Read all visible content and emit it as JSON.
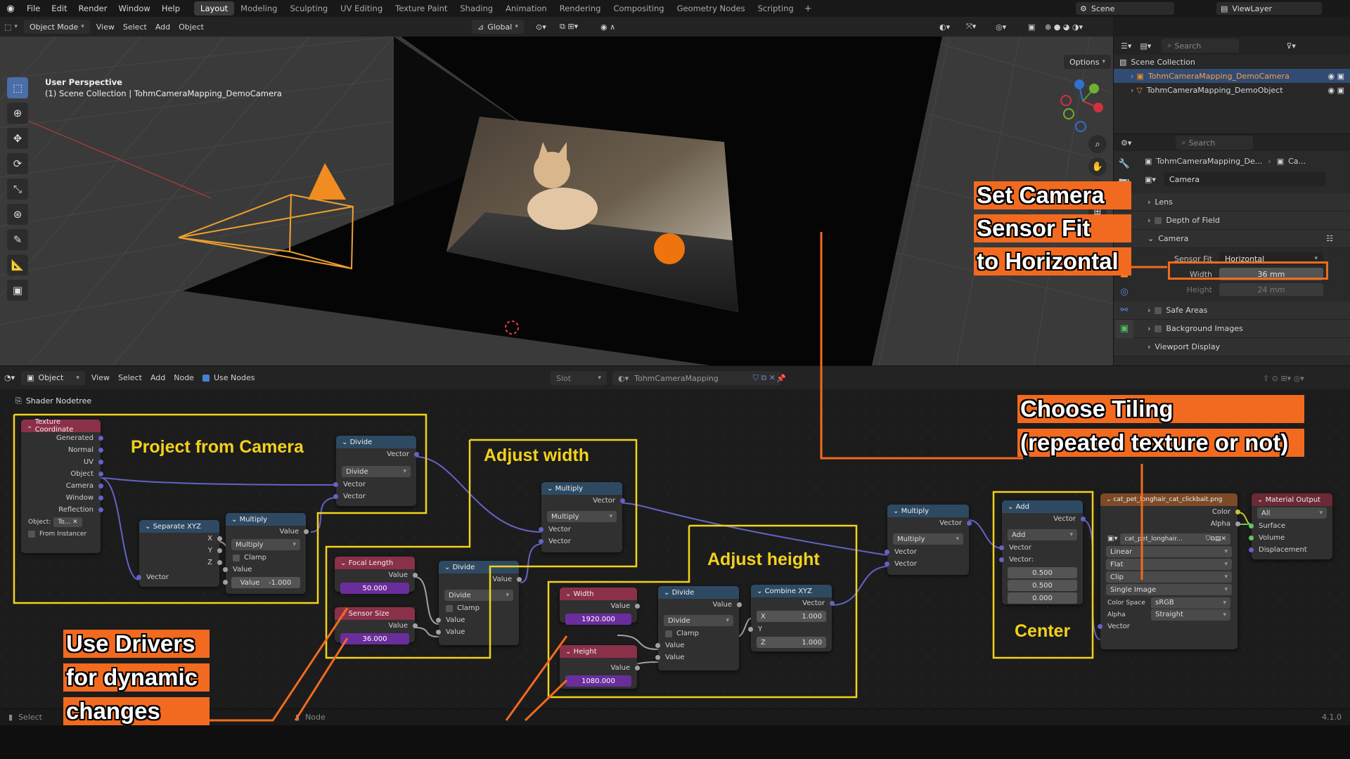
{
  "app": {
    "menus": [
      "File",
      "Edit",
      "Render",
      "Window",
      "Help"
    ],
    "workspaces": [
      "Layout",
      "Modeling",
      "Sculpting",
      "UV Editing",
      "Texture Paint",
      "Shading",
      "Animation",
      "Rendering",
      "Compositing",
      "Geometry Nodes",
      "Scripting"
    ],
    "active_workspace": "Layout",
    "scene": "Scene",
    "view_layer": "ViewLayer",
    "version": "4.1.0"
  },
  "viewport": {
    "mode": "Object Mode",
    "menus": [
      "View",
      "Select",
      "Add",
      "Object"
    ],
    "transform": "Global",
    "options": "Options",
    "title": "User Perspective",
    "subtitle": "(1) Scene Collection | TohmCameraMapping_DemoCamera"
  },
  "outliner": {
    "search_placeholder": "Search",
    "collection": "Scene Collection",
    "items": [
      "TohmCameraMapping_DemoCamera",
      "TohmCameraMapping_DemoObject"
    ]
  },
  "properties": {
    "search_placeholder": "Search",
    "breadcrumb_obj": "TohmCameraMapping_De...",
    "breadcrumb_data": "Ca...",
    "datablock": "Camera",
    "panels": {
      "lens": "Lens",
      "dof": "Depth of Field",
      "camera": "Camera",
      "safe_areas": "Safe Areas",
      "bg_images": "Background Images",
      "viewport_display": "Viewport Display"
    },
    "sensor_fit_label": "Sensor Fit",
    "sensor_fit_value": "Horizontal",
    "width_label": "Width",
    "width_value": "36 mm",
    "height_label": "Height",
    "height_value": "24 mm"
  },
  "node_editor": {
    "editor_type": "Object",
    "menus": [
      "View",
      "Select",
      "Add",
      "Node"
    ],
    "use_nodes": "Use Nodes",
    "slot": "Slot",
    "material": "TohmCameraMapping",
    "breadcrumb": "Shader Nodetree"
  },
  "nodes": {
    "texcoord": {
      "title": "Texture Coordinate",
      "outputs": [
        "Generated",
        "Normal",
        "UV",
        "Object",
        "Camera",
        "Window",
        "Reflection"
      ],
      "object_label": "Object:",
      "object_value": "To...",
      "from_instancer": "From Instancer"
    },
    "separate": {
      "title": "Separate XYZ",
      "x": "X",
      "y": "Y",
      "z": "Z",
      "input": "Vector"
    },
    "multiply1": {
      "title": "Multiply",
      "output": "Value",
      "op": "Multiply",
      "clamp": "Clamp",
      "in1": "Value",
      "in2_label": "Value",
      "in2_value": "-1.000"
    },
    "divide1": {
      "title": "Divide",
      "output": "Vector",
      "op": "Divide",
      "in1": "Vector",
      "in2": "Vector"
    },
    "focal": {
      "title": "Focal Length",
      "output": "Value",
      "value": "50.000"
    },
    "sensor": {
      "title": "Sensor Size",
      "output": "Value",
      "value": "36.000"
    },
    "divide2": {
      "title": "Divide",
      "output": "Value",
      "op": "Divide",
      "clamp": "Clamp",
      "in1": "Value",
      "in2": "Value"
    },
    "multiply2": {
      "title": "Multiply",
      "output": "Vector",
      "op": "Multiply",
      "in1": "Vector",
      "in2": "Vector"
    },
    "width": {
      "title": "Width",
      "output": "Value",
      "value": "1920.000"
    },
    "height": {
      "title": "Height",
      "output": "Value",
      "value": "1080.000"
    },
    "divide3": {
      "title": "Divide",
      "output": "Value",
      "op": "Divide",
      "clamp": "Clamp",
      "in1": "Value",
      "in2": "Value"
    },
    "combine": {
      "title": "Combine XYZ",
      "output": "Vector",
      "x_label": "X",
      "x_value": "1.000",
      "y_label": "Y",
      "z_label": "Z",
      "z_value": "1.000"
    },
    "multiply3": {
      "title": "Multiply",
      "output": "Vector",
      "op": "Multiply",
      "in1": "Vector",
      "in2": "Vector"
    },
    "add": {
      "title": "Add",
      "output": "Vector",
      "op": "Add",
      "in1": "Vector",
      "in2": "Vector:",
      "v1": "0.500",
      "v2": "0.500",
      "v3": "0.000"
    },
    "image": {
      "title": "cat_pet_longhair_cat_clickbait.png",
      "out_color": "Color",
      "out_alpha": "Alpha",
      "img_name": "cat_pet_longhair...",
      "interp": "Linear",
      "proj": "Flat",
      "ext": "Clip",
      "source": "Single Image",
      "cs_label": "Color Space",
      "cs_value": "sRGB",
      "alpha_label": "Alpha",
      "alpha_value": "Straight",
      "input": "Vector"
    },
    "output": {
      "title": "Material Output",
      "target": "All",
      "surface": "Surface",
      "volume": "Volume",
      "displacement": "Displacement"
    }
  },
  "annotations": {
    "project": "Project from Camera",
    "adjust_width": "Adjust width",
    "adjust_height": "Adjust height",
    "center": "Center",
    "sensor_fit": [
      "Set Camera",
      "Sensor Fit",
      "to Horizontal"
    ],
    "tiling": [
      "Choose Tiling",
      "(repeated texture or not)"
    ],
    "drivers": [
      "Use Drivers",
      "for dynamic",
      "changes"
    ]
  },
  "status": {
    "select": "Select",
    "node": "Node"
  },
  "colors": {
    "accent_orange": "#f26a1f",
    "box_yellow": "#f2d21c",
    "selected_text": "#f6a045",
    "selection_bg": "#324b73"
  }
}
